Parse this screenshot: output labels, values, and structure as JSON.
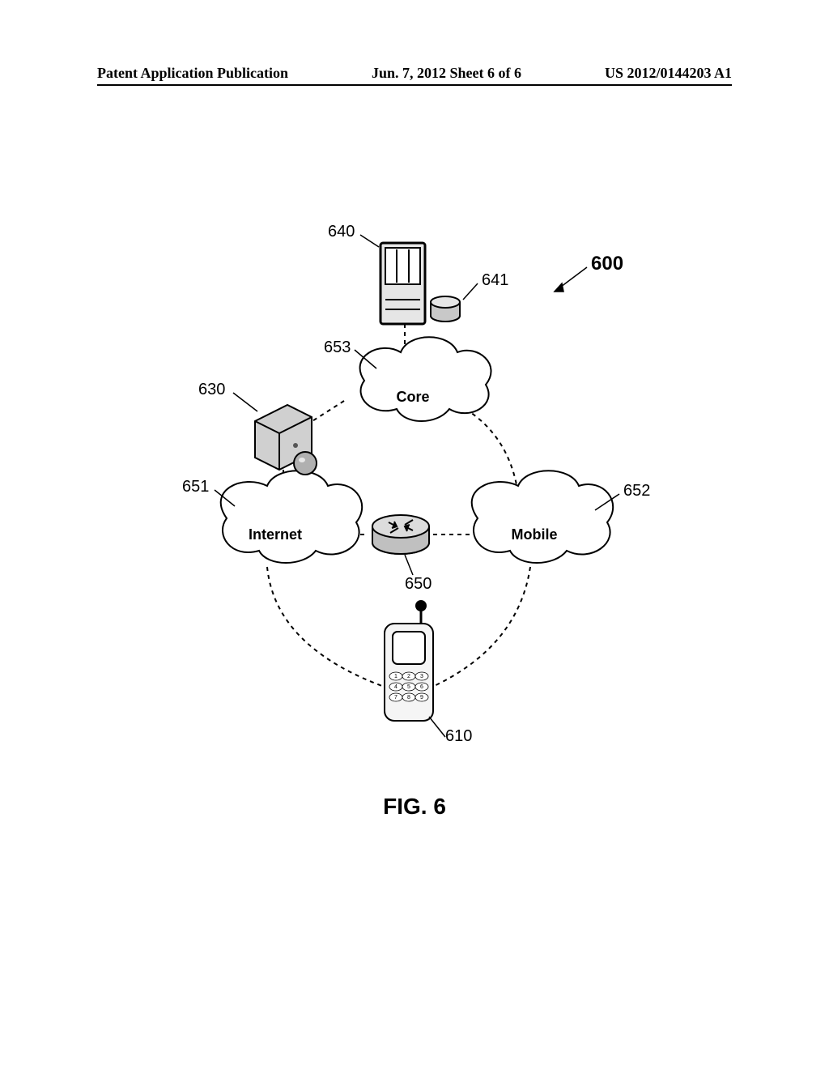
{
  "header": {
    "left": "Patent Application Publication",
    "center": "Jun. 7, 2012  Sheet 6 of 6",
    "right": "US 2012/0144203 A1"
  },
  "figure_caption": "FIG. 6",
  "labels": {
    "l600": "600",
    "l610": "610",
    "l630": "630",
    "l640": "640",
    "l641": "641",
    "l650": "650",
    "l651": "651",
    "l652": "652",
    "l653": "653"
  },
  "clouds": {
    "core": "Core",
    "internet": "Internet",
    "mobile": "Mobile"
  },
  "keypad": {
    "row1": [
      "1",
      "2",
      "3"
    ],
    "row2": [
      "4",
      "5",
      "6"
    ],
    "row3": [
      "7",
      "8",
      "9"
    ]
  }
}
